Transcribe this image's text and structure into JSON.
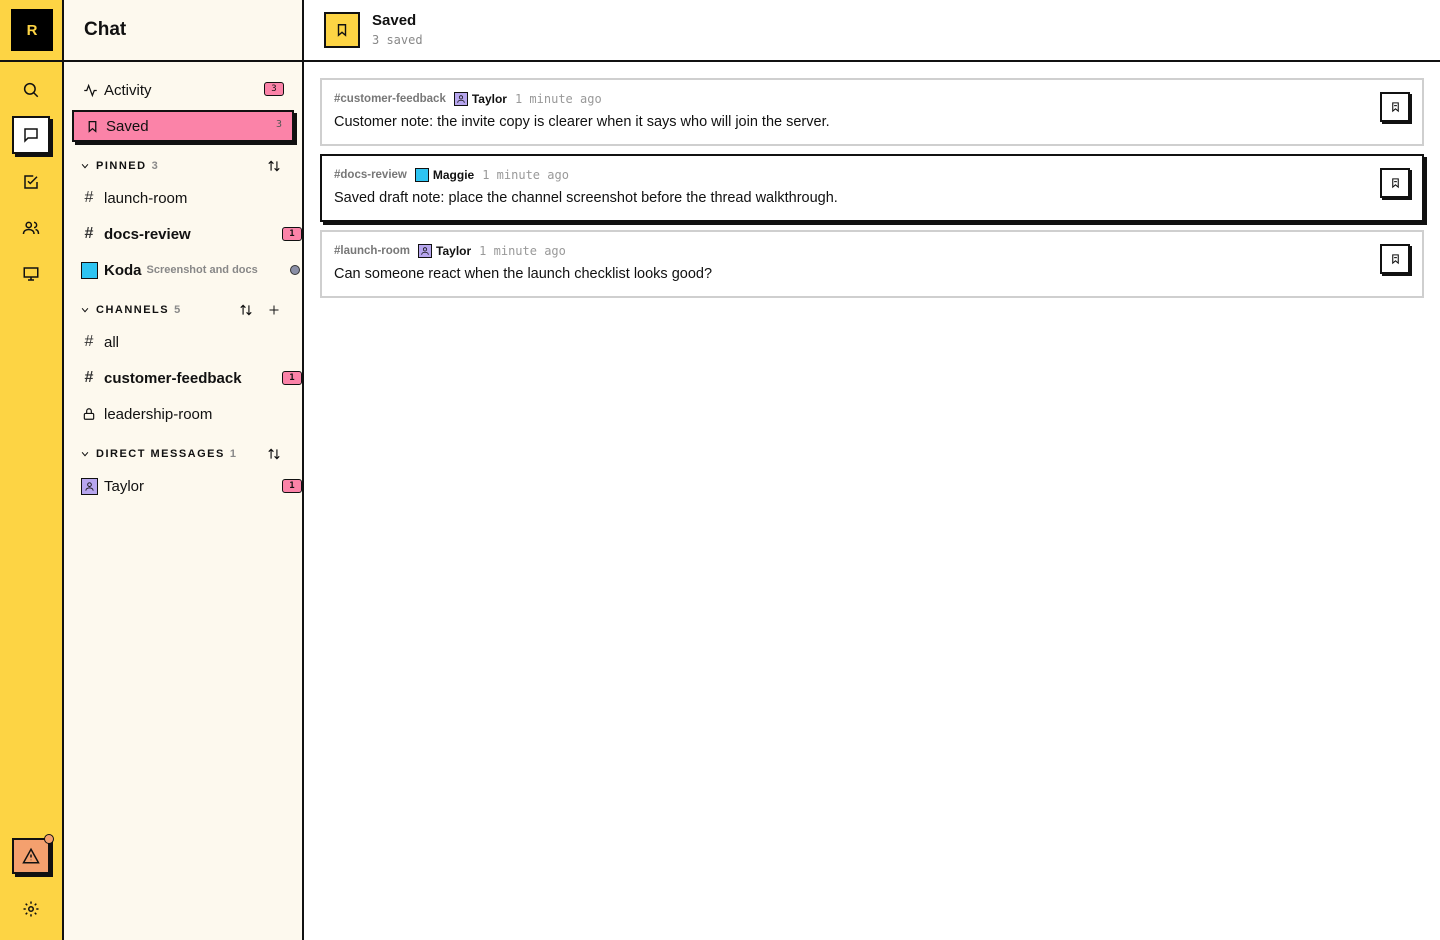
{
  "rail": {
    "logo_letter": "R",
    "items": [
      {
        "icon": "search-icon"
      },
      {
        "icon": "chat-icon",
        "active": true
      },
      {
        "icon": "checkbox-icon"
      },
      {
        "icon": "people-icon"
      },
      {
        "icon": "monitor-icon"
      }
    ],
    "bottom": [
      {
        "icon": "alert-icon"
      },
      {
        "icon": "gear-icon"
      }
    ]
  },
  "sidebar": {
    "title": "Chat",
    "activity": {
      "label": "Activity",
      "badge": "3"
    },
    "saved": {
      "label": "Saved",
      "count": "3"
    },
    "pinned": {
      "label": "PINNED",
      "count": "3",
      "items": [
        {
          "label": "launch-room"
        },
        {
          "label": "docs-review",
          "badge": "1"
        },
        {
          "label": "Koda",
          "preview": "Screenshot and docs"
        }
      ]
    },
    "channels": {
      "label": "CHANNELS",
      "count": "5",
      "items": [
        {
          "label": "all"
        },
        {
          "label": "customer-feedback",
          "badge": "1"
        },
        {
          "label": "leadership-room"
        }
      ]
    },
    "direct_messages": {
      "label": "DIRECT MESSAGES",
      "count": "1",
      "items": [
        {
          "label": "Taylor",
          "badge": "1"
        }
      ]
    }
  },
  "main": {
    "title": "Saved",
    "subtitle": "3 saved",
    "saved_items": [
      {
        "channel": "#customer-feedback",
        "author": "Taylor",
        "time": "1 minute ago",
        "text": "Customer note: the invite copy is clearer when it says who will join the server."
      },
      {
        "channel": "#docs-review",
        "author": "Maggie",
        "time": "1 minute ago",
        "text": "Saved draft note: place the channel screenshot before the thread walkthrough."
      },
      {
        "channel": "#launch-room",
        "author": "Taylor",
        "time": "1 minute ago",
        "text": "Can someone react when the launch checklist looks good?"
      }
    ]
  },
  "colors": {
    "rail_bg": "#fdd444",
    "sidebar_bg": "#fdf9ee",
    "accent_pink": "#fb83a8",
    "alert_orange": "#f4a06e",
    "avatar_purple": "#b7a6ee",
    "avatar_cyan": "#2ec4f2"
  }
}
